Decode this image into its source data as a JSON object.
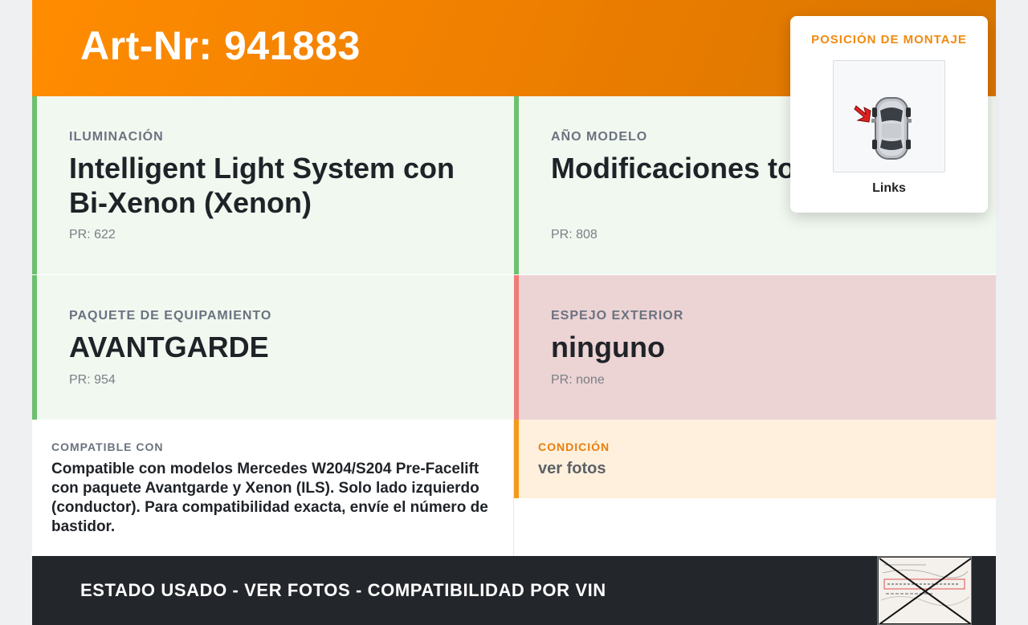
{
  "header": {
    "title": "Art-Nr: 941883"
  },
  "mounting": {
    "title": "POSICIÓN DE MONTAJE",
    "label": "Links",
    "icon": "car-top-view-icon"
  },
  "cells": {
    "lighting": {
      "label": "ILUMINACIÓN",
      "value": "Intelligent Light System con Bi-Xenon (Xenon)",
      "pr": "PR: 622"
    },
    "model_year": {
      "label": "AÑO MODELO",
      "value": "Modificaciones to Pre-Facelift",
      "pr": "PR: 808"
    },
    "equipment": {
      "label": "PAQUETE DE EQUIPAMIENTO",
      "value": "AVANTGARDE",
      "pr": "PR: 954"
    },
    "mirror": {
      "label": "ESPEJO EXTERIOR",
      "value": "ninguno",
      "pr": "PR: none"
    }
  },
  "compatible": {
    "label": "COMPATIBLE CON",
    "text": "Compatible con modelos Mercedes W204/S204 Pre-Facelift con paquete Avantgarde y Xenon (ILS). Solo lado izquierdo (conductor). Para compatibilidad exacta, envíe el número de bastidor."
  },
  "condition": {
    "label": "CONDICIÓN",
    "text": "ver fotos"
  },
  "footer": {
    "text": "ESTADO USADO - VER FOTOS - COMPATIBILIDAD POR VIN"
  },
  "colors": {
    "accent_orange": "#ff8c00",
    "match_green": "#6cc070",
    "mismatch_red": "#ef7a7a",
    "footer_dark": "#23262b"
  }
}
